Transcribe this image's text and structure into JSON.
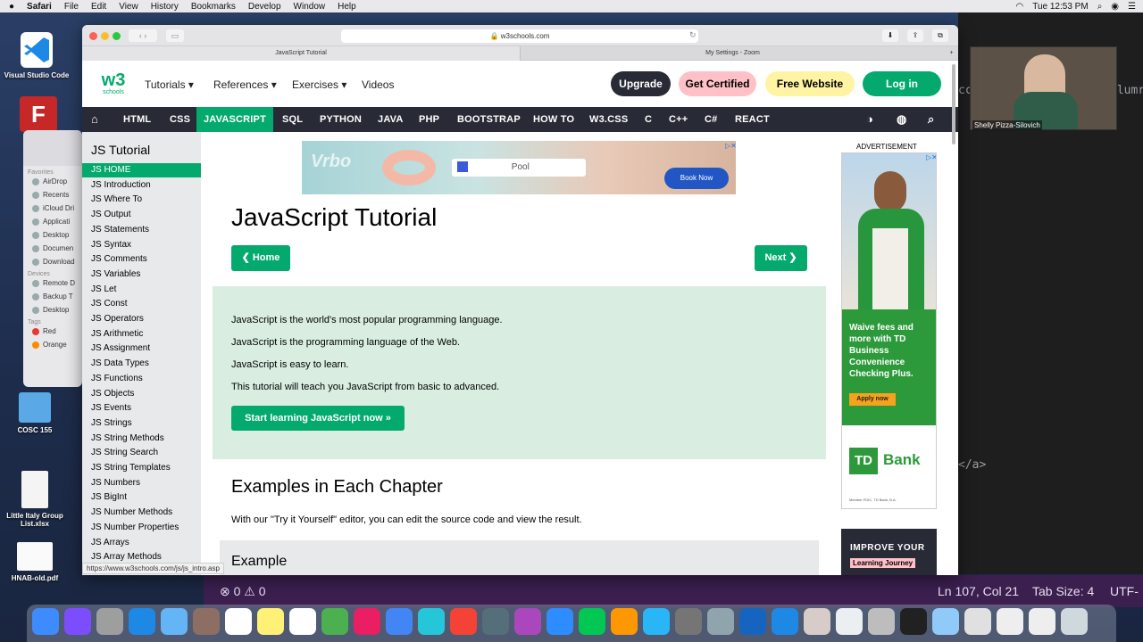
{
  "menubar": {
    "apple": "",
    "app": "Safari",
    "items": [
      "File",
      "Edit",
      "View",
      "History",
      "Bookmarks",
      "Develop",
      "Window",
      "Help"
    ],
    "clock": "Tue 12:53 PM"
  },
  "desktop": {
    "icons": [
      {
        "label": "Visual Studio Code"
      },
      {
        "label": "COSC 155"
      },
      {
        "label": "Little Italy Group List.xlsx"
      },
      {
        "label": "HNAB-old.pdf"
      }
    ]
  },
  "finder": {
    "favorites_label": "Favorites",
    "favorites": [
      "AirDrop",
      "Recents",
      "iCloud Dri",
      "Applicati",
      "Desktop",
      "Documen",
      "Download"
    ],
    "devices_label": "Devices",
    "devices": [
      "Remote D",
      "Backup T",
      "Desktop"
    ],
    "tags_label": "Tags",
    "tags": [
      "Red",
      "Orange"
    ]
  },
  "zoom": {
    "name": "Shelly Pizza-Silovich"
  },
  "safari": {
    "url": "w3schools.com",
    "tabs": [
      "JavaScript Tutorial",
      "My Settings - Zoom"
    ],
    "status_url": "https://www.w3schools.com/js/js_intro.asp"
  },
  "w3": {
    "logo": "w3",
    "logo_sup": "3",
    "logo_sub": "schools",
    "nav": [
      "Tutorials",
      "References",
      "Exercises",
      "Videos"
    ],
    "upgrade": "Upgrade",
    "certified": "Get Certified",
    "free_website": "Free Website",
    "login": "Log in",
    "topnav": [
      "HTML",
      "CSS",
      "JAVASCRIPT",
      "SQL",
      "PYTHON",
      "JAVA",
      "PHP",
      "BOOTSTRAP",
      "HOW TO",
      "W3.CSS",
      "C",
      "C++",
      "C#",
      "REACT"
    ],
    "sidebar_title": "JS Tutorial",
    "sidebar": [
      "JS HOME",
      "JS Introduction",
      "JS Where To",
      "JS Output",
      "JS Statements",
      "JS Syntax",
      "JS Comments",
      "JS Variables",
      "JS Let",
      "JS Const",
      "JS Operators",
      "JS Arithmetic",
      "JS Assignment",
      "JS Data Types",
      "JS Functions",
      "JS Objects",
      "JS Events",
      "JS Strings",
      "JS String Methods",
      "JS String Search",
      "JS String Templates",
      "JS Numbers",
      "JS BigInt",
      "JS Number Methods",
      "JS Number Properties",
      "JS Arrays",
      "JS Array Methods"
    ],
    "page_title": "JavaScript Tutorial",
    "home_btn": "❮ Home",
    "next_btn": "Next ❯",
    "intro": [
      "JavaScript is the world's most popular programming language.",
      "JavaScript is the programming language of the Web.",
      "JavaScript is easy to learn.",
      "This tutorial will teach you JavaScript from basic to advanced."
    ],
    "start_btn": "Start learning JavaScript now »",
    "examples_title": "Examples in Each Chapter",
    "examples_text": "With our \"Try it Yourself\" editor, you can edit the source code and view the result.",
    "example_box": "Example",
    "ad_top": {
      "field": "Pool",
      "button": "Book Now",
      "brand": "Vrbo"
    },
    "ad_label": "ADVERTISEMENT",
    "ad_side": {
      "text": "Waive fees and more with TD Business Convenience Checking Plus.",
      "button": "Apply now",
      "logo_box": "TD",
      "logo_text": "Bank",
      "fine": "Member FDIC, TD Bank, N.A."
    },
    "improve": {
      "line1": "IMPROVE YOUR",
      "line2": "Learning Journey"
    }
  },
  "editor": {
    "code1": "cc",
    "code2": "olumr",
    "code3": "</a>",
    "status_counts": "⊗ 0  ⚠ 0",
    "position": "Ln 107, Col 21",
    "tab_size": "Tab Size: 4",
    "encoding": "UTF-"
  },
  "colors": {
    "w3_green": "#04aa6d",
    "nav_dark": "#282a35",
    "intro_bg": "#d9eee1",
    "sidebar_bg": "#e7e9eb"
  }
}
